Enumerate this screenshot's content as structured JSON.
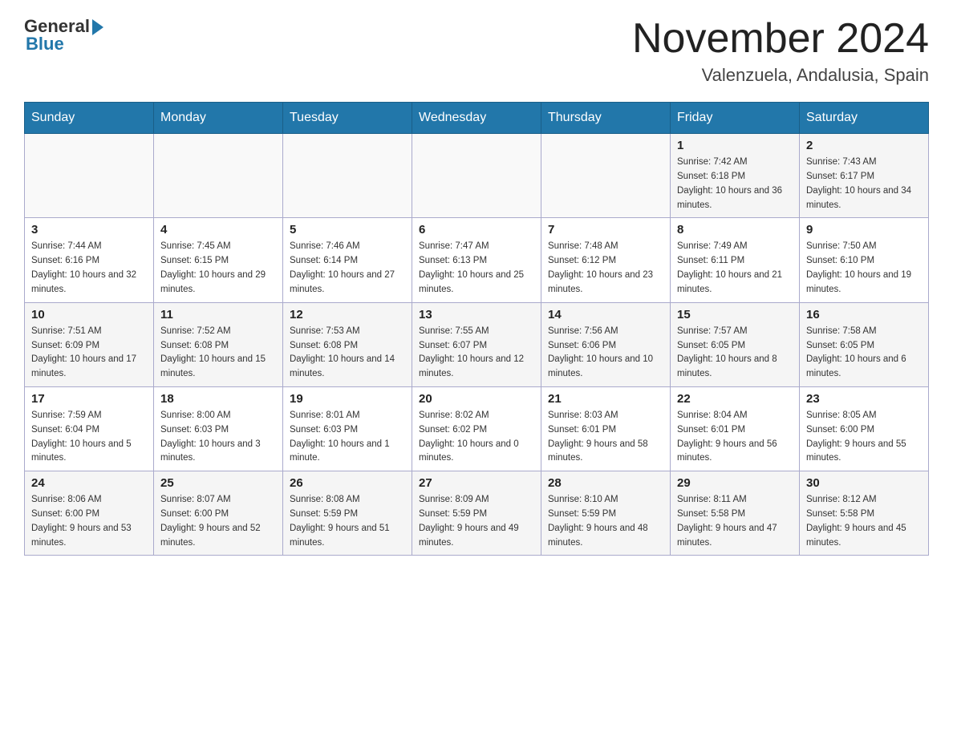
{
  "header": {
    "logo_general": "General",
    "logo_blue": "Blue",
    "month_title": "November 2024",
    "location": "Valenzuela, Andalusia, Spain"
  },
  "weekdays": [
    "Sunday",
    "Monday",
    "Tuesday",
    "Wednesday",
    "Thursday",
    "Friday",
    "Saturday"
  ],
  "weeks": [
    [
      {
        "day": "",
        "info": ""
      },
      {
        "day": "",
        "info": ""
      },
      {
        "day": "",
        "info": ""
      },
      {
        "day": "",
        "info": ""
      },
      {
        "day": "",
        "info": ""
      },
      {
        "day": "1",
        "info": "Sunrise: 7:42 AM\nSunset: 6:18 PM\nDaylight: 10 hours and 36 minutes."
      },
      {
        "day": "2",
        "info": "Sunrise: 7:43 AM\nSunset: 6:17 PM\nDaylight: 10 hours and 34 minutes."
      }
    ],
    [
      {
        "day": "3",
        "info": "Sunrise: 7:44 AM\nSunset: 6:16 PM\nDaylight: 10 hours and 32 minutes."
      },
      {
        "day": "4",
        "info": "Sunrise: 7:45 AM\nSunset: 6:15 PM\nDaylight: 10 hours and 29 minutes."
      },
      {
        "day": "5",
        "info": "Sunrise: 7:46 AM\nSunset: 6:14 PM\nDaylight: 10 hours and 27 minutes."
      },
      {
        "day": "6",
        "info": "Sunrise: 7:47 AM\nSunset: 6:13 PM\nDaylight: 10 hours and 25 minutes."
      },
      {
        "day": "7",
        "info": "Sunrise: 7:48 AM\nSunset: 6:12 PM\nDaylight: 10 hours and 23 minutes."
      },
      {
        "day": "8",
        "info": "Sunrise: 7:49 AM\nSunset: 6:11 PM\nDaylight: 10 hours and 21 minutes."
      },
      {
        "day": "9",
        "info": "Sunrise: 7:50 AM\nSunset: 6:10 PM\nDaylight: 10 hours and 19 minutes."
      }
    ],
    [
      {
        "day": "10",
        "info": "Sunrise: 7:51 AM\nSunset: 6:09 PM\nDaylight: 10 hours and 17 minutes."
      },
      {
        "day": "11",
        "info": "Sunrise: 7:52 AM\nSunset: 6:08 PM\nDaylight: 10 hours and 15 minutes."
      },
      {
        "day": "12",
        "info": "Sunrise: 7:53 AM\nSunset: 6:08 PM\nDaylight: 10 hours and 14 minutes."
      },
      {
        "day": "13",
        "info": "Sunrise: 7:55 AM\nSunset: 6:07 PM\nDaylight: 10 hours and 12 minutes."
      },
      {
        "day": "14",
        "info": "Sunrise: 7:56 AM\nSunset: 6:06 PM\nDaylight: 10 hours and 10 minutes."
      },
      {
        "day": "15",
        "info": "Sunrise: 7:57 AM\nSunset: 6:05 PM\nDaylight: 10 hours and 8 minutes."
      },
      {
        "day": "16",
        "info": "Sunrise: 7:58 AM\nSunset: 6:05 PM\nDaylight: 10 hours and 6 minutes."
      }
    ],
    [
      {
        "day": "17",
        "info": "Sunrise: 7:59 AM\nSunset: 6:04 PM\nDaylight: 10 hours and 5 minutes."
      },
      {
        "day": "18",
        "info": "Sunrise: 8:00 AM\nSunset: 6:03 PM\nDaylight: 10 hours and 3 minutes."
      },
      {
        "day": "19",
        "info": "Sunrise: 8:01 AM\nSunset: 6:03 PM\nDaylight: 10 hours and 1 minute."
      },
      {
        "day": "20",
        "info": "Sunrise: 8:02 AM\nSunset: 6:02 PM\nDaylight: 10 hours and 0 minutes."
      },
      {
        "day": "21",
        "info": "Sunrise: 8:03 AM\nSunset: 6:01 PM\nDaylight: 9 hours and 58 minutes."
      },
      {
        "day": "22",
        "info": "Sunrise: 8:04 AM\nSunset: 6:01 PM\nDaylight: 9 hours and 56 minutes."
      },
      {
        "day": "23",
        "info": "Sunrise: 8:05 AM\nSunset: 6:00 PM\nDaylight: 9 hours and 55 minutes."
      }
    ],
    [
      {
        "day": "24",
        "info": "Sunrise: 8:06 AM\nSunset: 6:00 PM\nDaylight: 9 hours and 53 minutes."
      },
      {
        "day": "25",
        "info": "Sunrise: 8:07 AM\nSunset: 6:00 PM\nDaylight: 9 hours and 52 minutes."
      },
      {
        "day": "26",
        "info": "Sunrise: 8:08 AM\nSunset: 5:59 PM\nDaylight: 9 hours and 51 minutes."
      },
      {
        "day": "27",
        "info": "Sunrise: 8:09 AM\nSunset: 5:59 PM\nDaylight: 9 hours and 49 minutes."
      },
      {
        "day": "28",
        "info": "Sunrise: 8:10 AM\nSunset: 5:59 PM\nDaylight: 9 hours and 48 minutes."
      },
      {
        "day": "29",
        "info": "Sunrise: 8:11 AM\nSunset: 5:58 PM\nDaylight: 9 hours and 47 minutes."
      },
      {
        "day": "30",
        "info": "Sunrise: 8:12 AM\nSunset: 5:58 PM\nDaylight: 9 hours and 45 minutes."
      }
    ]
  ]
}
